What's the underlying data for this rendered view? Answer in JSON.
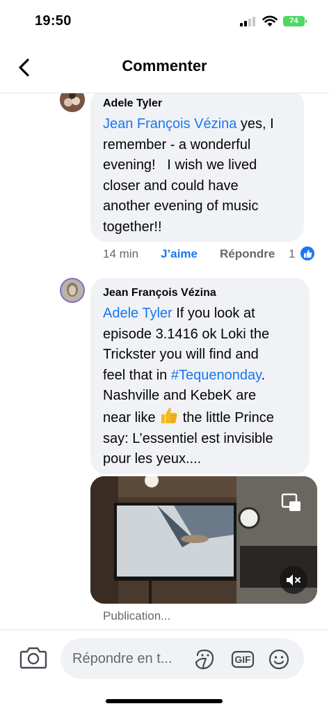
{
  "status_bar": {
    "time": "19:50",
    "battery": "74"
  },
  "header": {
    "title": "Commenter"
  },
  "comments": [
    {
      "author": "Adele Tyler",
      "lines": [
        {
          "mention": "Jean François Vézina",
          "text": " yes, I"
        },
        {
          "text": "remember - a wonderful"
        },
        {
          "text": "evening!   I wish we lived"
        },
        {
          "text": "closer and could have"
        },
        {
          "text": "another evening of music"
        },
        {
          "text": "together!!"
        }
      ],
      "time": "14 min",
      "like_label": "J’aime",
      "reply_label": "Répondre",
      "reaction_count": "1"
    },
    {
      "author": "Jean François Vézina",
      "lines": [
        {
          "mention": "Adele Tyler",
          "text": " If you look at"
        },
        {
          "text": "episode 3.1416 ok Loki the"
        },
        {
          "text": "Trickster you will find and"
        },
        {
          "pre": "feel that in ",
          "hashtag": "#Tequenonday",
          "post": "."
        },
        {
          "text": "Nashville and KebeK are"
        },
        {
          "pre": "near like ",
          "emoji": "👍",
          "post": " the little Prince"
        },
        {
          "text": "say: L’essentiel est invisible"
        },
        {
          "text": "pour les yeux...."
        }
      ],
      "status": "Publication..."
    }
  ],
  "composer": {
    "placeholder": "Répondre en t..."
  },
  "icons": {
    "back": "chevron-left-icon",
    "camera": "camera-icon",
    "sticker": "sticker-icon",
    "gif": "gif-icon",
    "emoji": "smiley-icon",
    "pip": "picture-in-picture-icon",
    "mute": "speaker-muted-icon",
    "like": "thumbs-up-icon"
  },
  "gif_label": "GIF",
  "colors": {
    "accent": "#1877f2",
    "bubble": "#f0f2f5",
    "meta": "#65676b",
    "battery": "#4cd964"
  }
}
